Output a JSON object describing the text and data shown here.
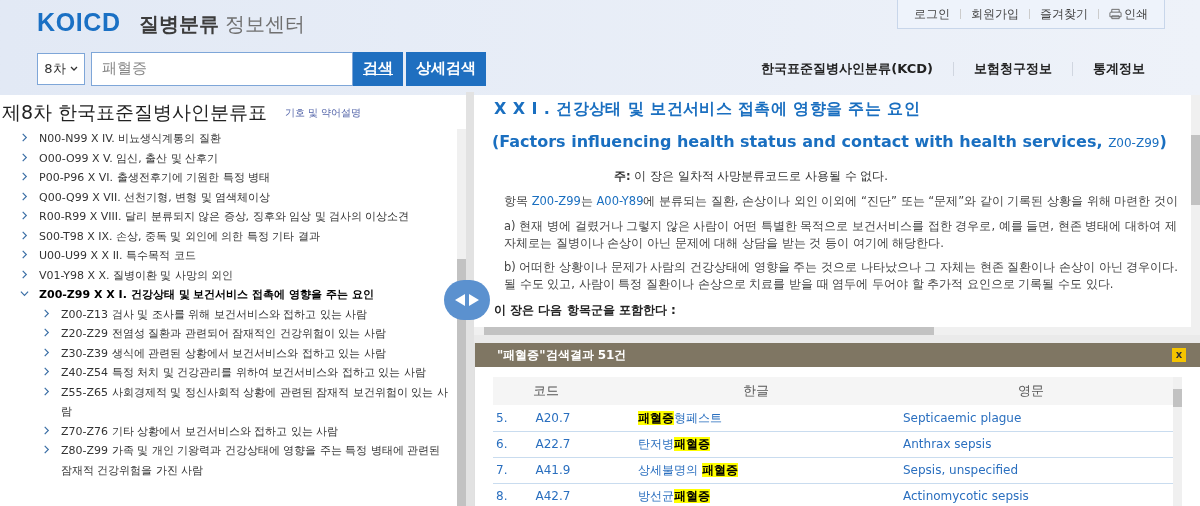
{
  "logo": {
    "brand": "KOICD",
    "title_bold": "질병분류",
    "title_light": "정보센터"
  },
  "top_links": [
    "로그인",
    "회원가입",
    "즐겨찾기",
    "인쇄"
  ],
  "search": {
    "version": "8차",
    "value": "패혈증",
    "buttons": [
      "검색",
      "상세검색"
    ]
  },
  "main_nav": [
    "한국표준질병사인분류(KCD)",
    "보험청구정보",
    "통계정보"
  ],
  "left_panel": {
    "title": "제8차 한국표준질병사인분류표",
    "legend_button": "기호 및 약어설명",
    "tree": [
      {
        "label": "N00-N99  X IV. 비뇨생식계통의 질환",
        "expanded": false
      },
      {
        "label": "O00-O99  X V. 임신, 출산 및 산후기",
        "expanded": false
      },
      {
        "label": "P00-P96  X VI. 출생전후기에 기원한 특정 병태",
        "expanded": false
      },
      {
        "label": "Q00-Q99  X VII. 선천기형, 변형 및 염색체이상",
        "expanded": false
      },
      {
        "label": "R00-R99  X VIII. 달리 분류되지 않은 증상, 징후와 임상 및 검사의 이상소견",
        "expanded": false
      },
      {
        "label": "S00-T98  X IX. 손상, 중독 및 외인에 의한 특정 기타 결과",
        "expanded": false
      },
      {
        "label": "U00-U99  X X II. 특수목적 코드",
        "expanded": false
      },
      {
        "label": "V01-Y98  X X. 질병이환 및 사망의 외인",
        "expanded": false
      },
      {
        "label": "Z00-Z99  X X I. 건강상태 및 보건서비스 접촉에 영향을 주는 요인",
        "expanded": true,
        "children": [
          {
            "label": "Z00-Z13 검사 및 조사를 위해 보건서비스와 접하고 있는 사람",
            "expanded": false
          },
          {
            "label": "Z20-Z29 전염성 질환과 관련되어 잠재적인 건강위험이 있는 사람",
            "expanded": false
          },
          {
            "label": "Z30-Z39 생식에 관련된 상황에서 보건서비스와 접하고 있는 사람",
            "expanded": false
          },
          {
            "label": "Z40-Z54 특정 처치 및 건강관리를 위하여 보건서비스와 접하고 있는 사람",
            "expanded": false
          },
          {
            "label": "Z55-Z65 사회경제적 및 정신사회적 상황에 관련된 잠재적 보건위험이 있는 사람",
            "expanded": false
          },
          {
            "label": "Z70-Z76 기타 상황에서 보건서비스와 접하고 있는 사람",
            "expanded": false
          },
          {
            "label": "Z80-Z99 가족 및 개인 기왕력과 건강상태에 영향을 주는 특정 병태에 관련된 잠재적 건강위험을 가진 사람",
            "expanded": false
          }
        ]
      }
    ]
  },
  "chapter": {
    "title": "X X I . 건강상태 및 보건서비스 접촉에 영향을 주는 요인",
    "english_title": "(Factors influencing health status and contact with health services,",
    "english_code": "Z00-Z99",
    "english_close": ")",
    "note_label": "주:",
    "note": "이 장은 일차적 사망분류코드로 사용될 수 없다.",
    "intro": [
      {
        "kind": "text",
        "text": "항목 "
      },
      {
        "kind": "link",
        "text": "Z00-Z99"
      },
      {
        "kind": "text",
        "text": "는 "
      },
      {
        "kind": "link",
        "text": "A00-Y89"
      },
      {
        "kind": "text",
        "text": "에 분류되는 질환, 손상이나 외인 이외에 “진단” 또는 “문제”와 같이 기록된 상황을 위해 마련한 것이"
      }
    ],
    "paragraphs": [
      [
        "a) 현재 병에 걸렸거나 그렇지 않은 사람이 어떤 특별한 목적으로 보건서비스를 접한 경우로, 예를 들면, 현존 병태에 대하여 제",
        "자체로는 질병이나 손상이 아닌 문제에 대해 상담을 받는 것 등이 여기에 해당한다."
      ],
      [
        "b) 어떠한 상황이나 문제가 사람의 건강상태에 영향을 주는 것으로 나타났으나 그 자체는 현존 질환이나 손상이 아닌 경우이다.",
        "될 수도 있고, 사람이 특정 질환이나 손상으로 치료를 받을 때 염두에 두어야 할 추가적 요인으로 기록될 수도 있다."
      ]
    ],
    "includes": "이 장은 다음 항목군을 포함한다 :"
  },
  "results": {
    "title": "\"패혈증\"검색결과 51건",
    "close": "x",
    "columns": [
      "코드",
      "한글",
      "영문"
    ],
    "rows": [
      {
        "no": "5.",
        "code": "A20.7",
        "korean": "**패혈증**형페스트",
        "english": "Septicaemic plague"
      },
      {
        "no": "6.",
        "code": "A22.7",
        "korean": "탄저병**패혈증**",
        "english": "Anthrax sepsis"
      },
      {
        "no": "7.",
        "code": "A41.9",
        "korean": "상세불명의 **패혈증**",
        "english": "Sepsis, unspecified"
      },
      {
        "no": "8.",
        "code": "A42.7",
        "korean": "방선균**패혈증**",
        "english": "Actinomycotic sepsis"
      }
    ]
  }
}
